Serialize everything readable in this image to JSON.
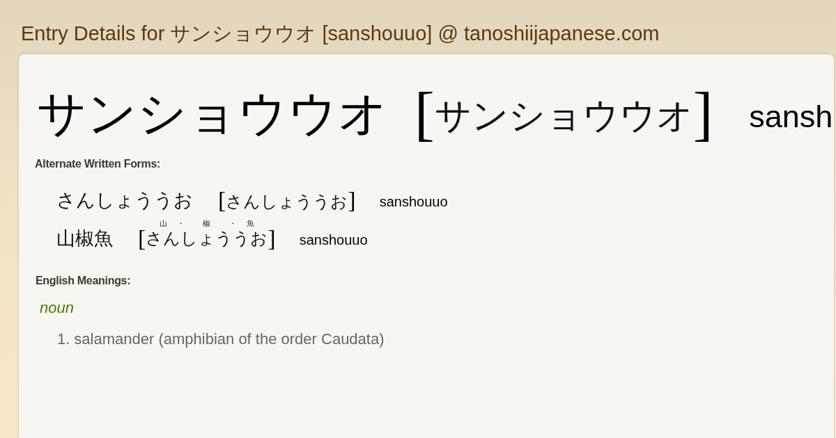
{
  "page": {
    "title": "Entry Details for サンショウウオ [sanshouuo] @ tanoshiijapanese.com"
  },
  "entry": {
    "word": "サンショウウオ",
    "reading": {
      "open": "[",
      "parts": [
        {
          "text": "サンショウウオ"
        }
      ],
      "close": "]"
    },
    "romaji": "sansh"
  },
  "alternate_forms": {
    "heading": "Alternate Written Forms:",
    "forms": [
      {
        "written": "さんしょううお",
        "reading": {
          "open": "[",
          "parts": [
            {
              "text": "さんしょううお"
            }
          ],
          "close": "]"
        },
        "romaji": "sanshouuo"
      },
      {
        "written": "山椒魚",
        "reading": {
          "open": "[",
          "parts": [
            {
              "text": "さん",
              "ruby": "山"
            },
            {
              "text": "しょう",
              "ruby": "椒",
              "separator": "・"
            },
            {
              "text": "うお",
              "ruby": "魚",
              "separator": "・"
            }
          ],
          "close": "]"
        },
        "romaji": "sanshouuo"
      }
    ]
  },
  "meanings": {
    "heading": "English Meanings:",
    "groups": [
      {
        "part_of_speech": "noun",
        "senses": [
          {
            "number": "1.",
            "text": "salamander (amphibian of the order Caudata)"
          }
        ]
      }
    ]
  }
}
